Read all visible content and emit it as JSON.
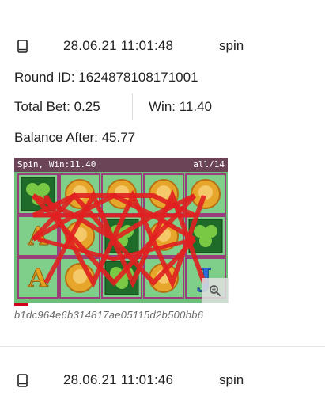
{
  "entries": [
    {
      "datetime": "28.06.21 11:01:48",
      "type": "spin",
      "round_id_label": "Round ID: 1624878108171001",
      "total_bet_label": "Total Bet: 0.25",
      "win_label": "Win: 11.40",
      "balance_after_label": "Balance After: 45.77",
      "preview": {
        "status_left": "Spin, Win:11.40",
        "status_right": "all/14",
        "symbols": [
          [
            "clover",
            "coin",
            "coin",
            "coin",
            "coin"
          ],
          [
            "ace",
            "coin",
            "clover",
            "coin",
            "clover"
          ],
          [
            "ace",
            "coin",
            "clover",
            "coin",
            "jack"
          ]
        ]
      },
      "hash": "b1dc964e6b314817ae05115d2b500bb6"
    },
    {
      "datetime": "28.06.21 11:01:46",
      "type": "spin"
    }
  ],
  "icons": {
    "device": "mobile-phone-icon",
    "zoom": "zoom-in-icon"
  },
  "colors": {
    "reel_background": "#6cc07a",
    "status_bar": "#6b4458",
    "paylines": "#e02020",
    "cell_border": "#9b3f7c"
  }
}
